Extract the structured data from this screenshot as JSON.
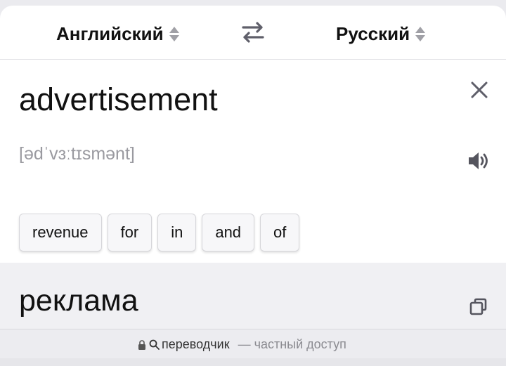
{
  "header": {
    "source_language": "Английский",
    "target_language": "Русский"
  },
  "input": {
    "word": "advertisement",
    "transcription": "[ədˈvɜːtɪsmənt]"
  },
  "suggestions": [
    "revenue",
    "for",
    "in",
    "and",
    "of"
  ],
  "result": {
    "translation": "реклама"
  },
  "footer": {
    "site_name": "переводчик",
    "subtitle": "— частный доступ"
  },
  "icons": {
    "swap": "swap-arrows-icon",
    "close": "close-icon",
    "speaker": "speaker-icon",
    "copy": "copy-icon",
    "lock": "lock-icon",
    "search": "search-icon"
  }
}
